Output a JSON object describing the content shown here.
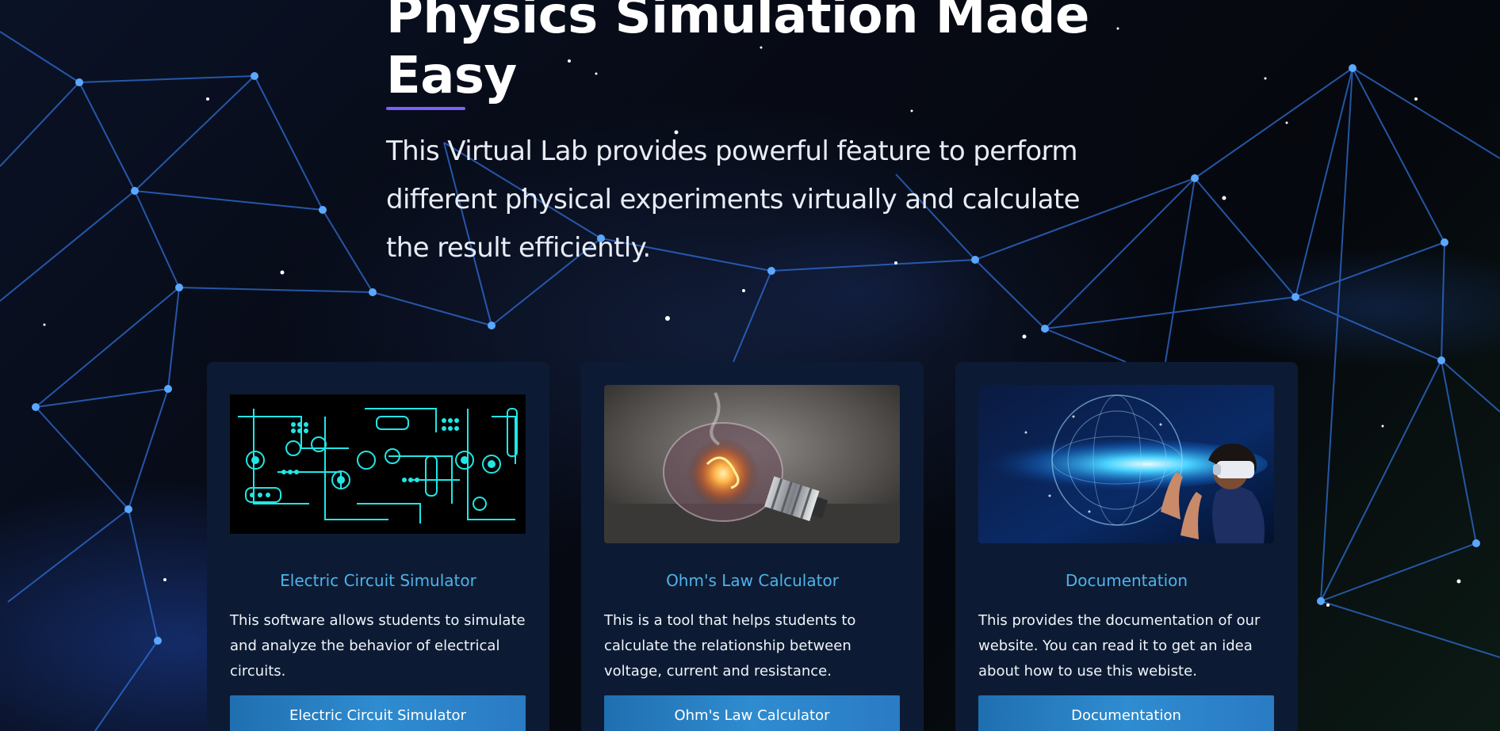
{
  "hero": {
    "title": "Physics Simulation Made Easy",
    "description": "This Virtual Lab provides powerful feature to perform different physical experiments virtually and calculate the result efficiently."
  },
  "cards": [
    {
      "image_icon": "circuit-board-image",
      "title": "Electric Circuit Simulator",
      "text": "This software allows students to simulate and analyze the behavior of electrical circuits.",
      "button": "Electric Circuit Simulator"
    },
    {
      "image_icon": "light-bulb-image",
      "title": "Ohm's Law Calculator",
      "text": "This is a tool that helps students to calculate the relationship between voltage, current and resistance.",
      "button": "Ohm's Law Calculator"
    },
    {
      "image_icon": "vr-globe-image",
      "title": "Documentation",
      "text": "This provides the documentation of our website. You can read it to get an idea about how to use this webiste.",
      "button": "Documentation"
    }
  ],
  "colors": {
    "accent_underline": "#7b61ff",
    "card_title": "#4fb3ea",
    "card_bg": "#0c1b33",
    "button": "#2a7bc4"
  }
}
